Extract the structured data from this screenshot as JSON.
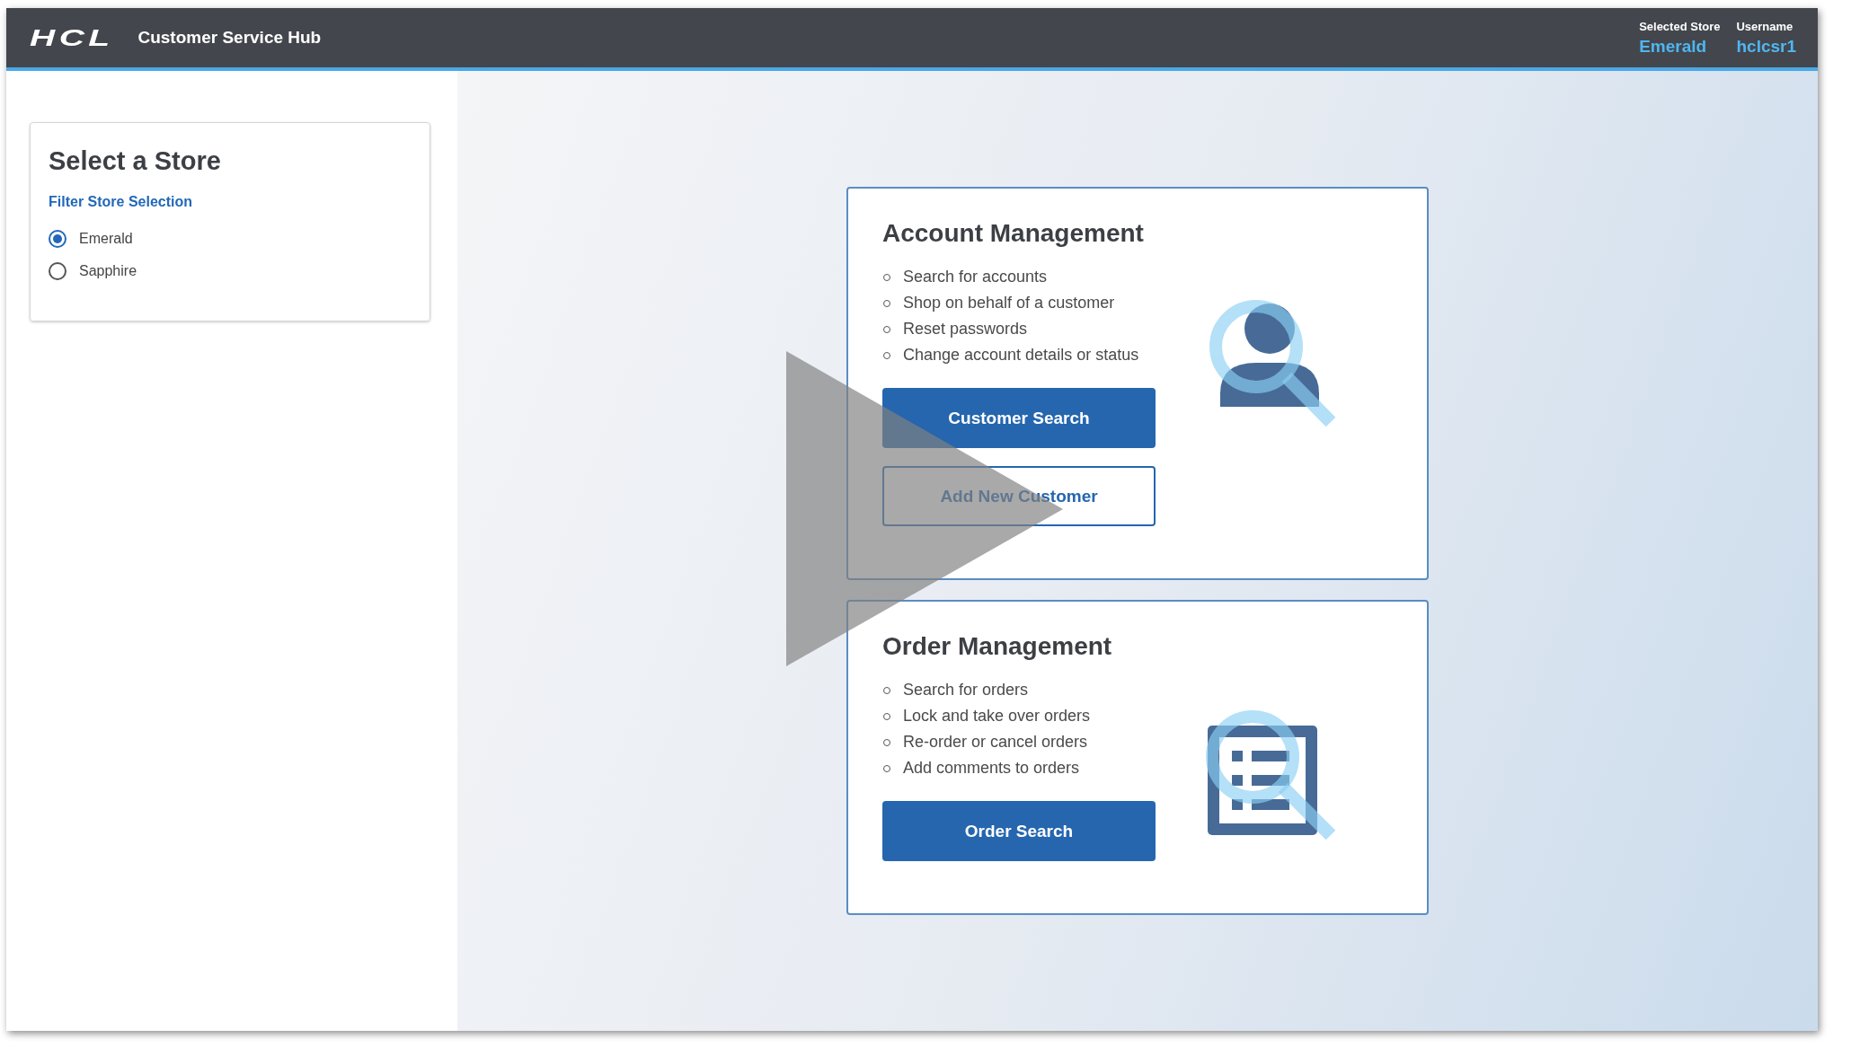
{
  "header": {
    "logo": "HCL",
    "title": "Customer Service Hub",
    "selected_store": {
      "label": "Selected Store",
      "value": "Emerald"
    },
    "username": {
      "label": "Username",
      "value": "hclcsr1"
    }
  },
  "store_panel": {
    "title": "Select a Store",
    "filter_link": "Filter Store Selection",
    "stores": [
      {
        "label": "Emerald",
        "selected": true
      },
      {
        "label": "Sapphire",
        "selected": false
      }
    ]
  },
  "cards": [
    {
      "kind": "account",
      "title": "Account Management",
      "items": [
        "Search for accounts",
        "Shop on behalf of a customer",
        "Reset passwords",
        "Change account details or status"
      ],
      "buttons": [
        {
          "label": "Customer Search",
          "kind": "primary"
        },
        {
          "label": "Add New Customer",
          "kind": "secondary"
        }
      ]
    },
    {
      "kind": "order",
      "title": "Order Management",
      "items": [
        "Search for orders",
        "Lock and take over orders",
        "Re-order or cancel orders",
        "Add comments to orders"
      ],
      "buttons": [
        {
          "label": "Order Search",
          "kind": "primary"
        }
      ]
    }
  ],
  "video_overlay": {
    "kind": "play"
  }
}
